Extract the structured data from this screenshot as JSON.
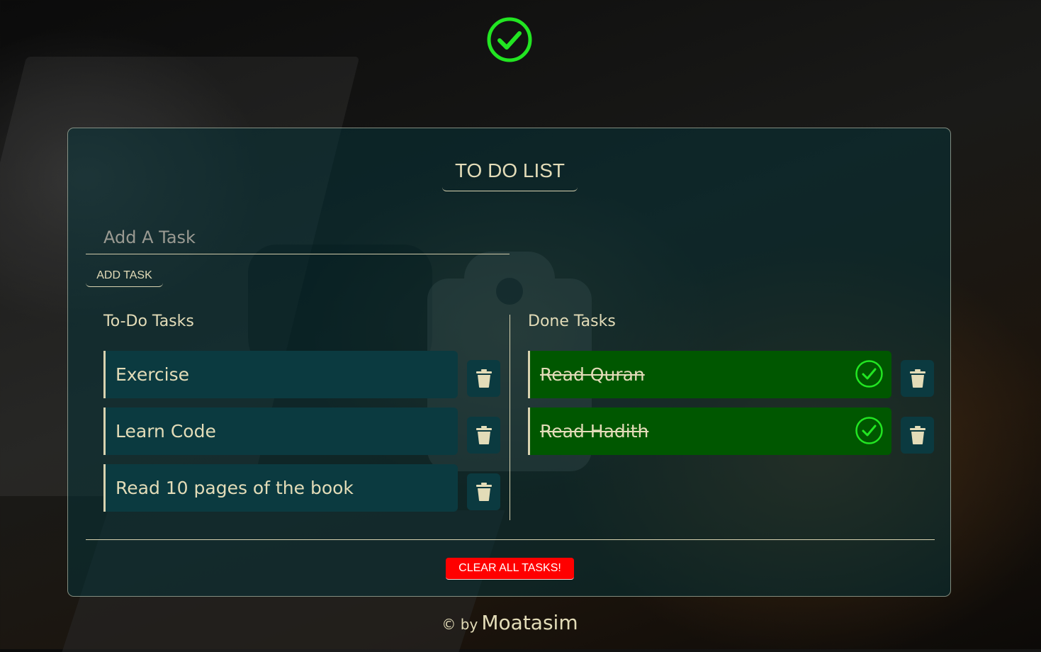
{
  "app": {
    "title": "TO DO LIST",
    "accent_color": "#22e522",
    "card_color": "#0b3a40",
    "done_color": "#005700",
    "danger_color": "#ff0000"
  },
  "input": {
    "placeholder": "Add A Task",
    "value": ""
  },
  "add_button": {
    "label": "ADD TASK"
  },
  "todo": {
    "title": "To-Do Tasks",
    "tasks": [
      "Exercise",
      "Learn Code",
      "Read 10 pages of the book"
    ]
  },
  "done": {
    "title": "Done Tasks",
    "tasks": [
      "Read Quran",
      "Read Hadith"
    ]
  },
  "clear_button": {
    "label": "CLEAR ALL TASKS!"
  },
  "footer": {
    "prefix": "© by",
    "author": "Moatasim"
  },
  "icons": {
    "header": "check-circle-icon",
    "delete": "trash-icon",
    "done": "check-circle-icon"
  }
}
